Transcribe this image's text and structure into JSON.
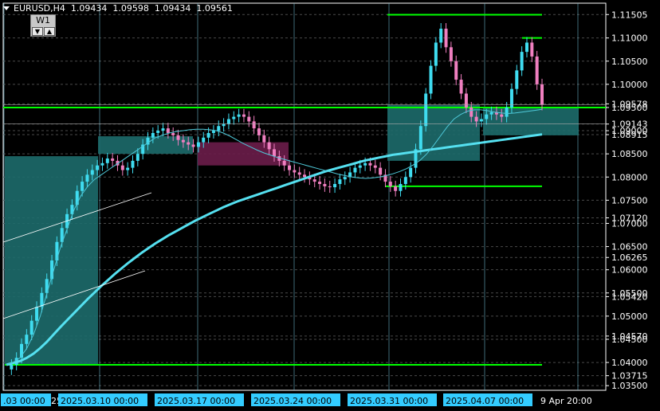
{
  "header": {
    "symbol": "EURUSD,H4",
    "open": "1.09434",
    "high": "1.09598",
    "low": "1.09434",
    "close": "1.09561"
  },
  "period_widget": {
    "label": "W1",
    "down_icon": "▼",
    "up_icon": "▲"
  },
  "colors": {
    "background": "#000000",
    "grid": "#4a4a4a",
    "bull": "#3fdcf0",
    "bear": "#f07fc0",
    "ma_slow": "#55e0f0",
    "ma_fast": "#4ec8d8",
    "level_green": "#00ff00",
    "box_teal": "#1d6b6b",
    "box_purple": "#6b1d4a",
    "axis_text": "#ffffff",
    "label_bg": "#33ccff"
  },
  "chart_data": {
    "type": "candlestick",
    "symbol": "EURUSD",
    "timeframe": "H4",
    "ylim": [
      1.034,
      1.1175
    ],
    "price_axis_labels": [
      "1.11505",
      "1.11000",
      "1.10500",
      "1.10000",
      "1.09578",
      "1.09500",
      "1.09143",
      "1.09000",
      "1.08915",
      "1.08500",
      "1.08000",
      "1.07500",
      "1.07120",
      "1.07000",
      "1.06500",
      "1.06265",
      "1.06000",
      "1.05500",
      "1.05420",
      "1.05000",
      "1.04570",
      "1.04500",
      "1.04000",
      "1.03715",
      "1.03500"
    ],
    "time_axis_labels": [
      {
        "text": ".03 00:00",
        "highlight": true
      },
      {
        "text": "25",
        "highlight": false
      },
      {
        "text": "2025.03.10 00:00",
        "highlight": true
      },
      {
        "text": "2025.03.17 00:00",
        "highlight": true
      },
      {
        "text": "2025.03.24 00:00",
        "highlight": true
      },
      {
        "text": "2025.03.31 00:00",
        "highlight": true
      },
      {
        "text": "2025.04.07 00:00",
        "highlight": true
      },
      {
        "text": "9 Apr 20:00",
        "highlight": false
      }
    ],
    "series": [
      {
        "kind": "close_path",
        "values": [
          1.0385,
          1.0395,
          1.041,
          1.044,
          1.046,
          1.049,
          1.052,
          1.055,
          1.058,
          1.062,
          1.066,
          1.069,
          1.072,
          1.074,
          1.077,
          1.079,
          1.0805,
          1.0815,
          1.0825,
          1.083,
          1.084,
          1.0835,
          1.0825,
          1.0815,
          1.082,
          1.0835,
          1.085,
          1.087,
          1.0885,
          1.0895,
          1.09,
          1.0905,
          1.0895,
          1.089,
          1.088,
          1.0875,
          1.087,
          1.0865,
          1.0875,
          1.0885,
          1.0895,
          1.09,
          1.091,
          1.0915,
          1.0925,
          1.093,
          1.0935,
          1.093,
          1.092,
          1.0905,
          1.089,
          1.0875,
          1.086,
          1.0845,
          1.0835,
          1.0825,
          1.0815,
          1.081,
          1.0805,
          1.08,
          1.0795,
          1.079,
          1.0785,
          1.078,
          1.0778,
          1.0785,
          1.0795,
          1.08,
          1.081,
          1.082,
          1.0825,
          1.083,
          1.0825,
          1.082,
          1.0805,
          1.079,
          1.078,
          1.077,
          1.0785,
          1.08,
          1.082,
          1.086,
          1.091,
          1.098,
          1.104,
          1.109,
          1.112,
          1.108,
          1.105,
          1.101,
          1.098,
          1.095,
          1.093,
          1.092,
          1.0925,
          1.0935,
          1.094,
          1.0935,
          1.093,
          1.095,
          1.099,
          1.103,
          1.107,
          1.109,
          1.106,
          1.1,
          1.0956
        ]
      },
      {
        "kind": "slow_ma",
        "values": [
          1.0395,
          1.0399,
          1.0403,
          1.041,
          1.0419,
          1.0431,
          1.0445,
          1.0461,
          1.0477,
          1.0492,
          1.0507,
          1.0522,
          1.0537,
          1.0551,
          1.0565,
          1.0578,
          1.0591,
          1.0603,
          1.0615,
          1.0626,
          1.0637,
          1.0647,
          1.0657,
          1.0666,
          1.0675,
          1.0683,
          1.0691,
          1.0699,
          1.0707,
          1.0714,
          1.0721,
          1.0728,
          1.0735,
          1.0741,
          1.0747,
          1.0752,
          1.0757,
          1.0762,
          1.0767,
          1.0772,
          1.0777,
          1.0782,
          1.0787,
          1.0792,
          1.0797,
          1.0802,
          1.0807,
          1.0812,
          1.0816,
          1.082,
          1.0824,
          1.0828,
          1.0832,
          1.0836,
          1.0839,
          1.0842,
          1.0845,
          1.0848,
          1.085,
          1.0852,
          1.0854,
          1.0856,
          1.0858,
          1.086,
          1.0862,
          1.0864,
          1.0866,
          1.0868,
          1.087,
          1.0872,
          1.0874,
          1.0876,
          1.0878,
          1.088,
          1.0882,
          1.0884,
          1.0886,
          1.0888,
          1.089,
          1.0892
        ]
      },
      {
        "kind": "fast_ma",
        "values": [
          1.0395,
          1.04,
          1.041,
          1.043,
          1.046,
          1.05,
          1.055,
          1.06,
          1.065,
          1.069,
          1.073,
          1.076,
          1.078,
          1.0795,
          1.0805,
          1.0815,
          1.0825,
          1.0835,
          1.0845,
          1.0855,
          1.0865,
          1.0875,
          1.0885,
          1.089,
          1.0895,
          1.0898,
          1.09,
          1.0902,
          1.0903,
          1.0903,
          1.0902,
          1.09,
          1.0895,
          1.0888,
          1.088,
          1.0872,
          1.0865,
          1.0858,
          1.0852,
          1.0847,
          1.0842,
          1.0838,
          1.0834,
          1.083,
          1.0826,
          1.0822,
          1.0818,
          1.0814,
          1.081,
          1.0806,
          1.0803,
          1.08,
          1.0798,
          1.0797,
          1.0798,
          1.08,
          1.0803,
          1.0807,
          1.0812,
          1.0818,
          1.0826,
          1.0836,
          1.085,
          1.0868,
          1.0888,
          1.0908,
          1.0925,
          1.0935,
          1.0942,
          1.0945,
          1.0945,
          1.0943,
          1.094,
          1.0938,
          1.0937,
          1.0938,
          1.094,
          1.0942,
          1.0944,
          1.0946
        ]
      }
    ],
    "levels": [
      1.115,
      1.11,
      1.095,
      1.078,
      1.0395
    ],
    "zones": [
      {
        "color": "teal",
        "from": 1.0395,
        "to": 1.0845
      },
      {
        "color": "teal",
        "from": 1.085,
        "to": 1.0888
      },
      {
        "color": "purple",
        "from": 1.0825,
        "to": 1.0875
      },
      {
        "color": "teal",
        "from": 1.0835,
        "to": 1.0955
      },
      {
        "color": "teal",
        "from": 1.089,
        "to": 1.095
      }
    ],
    "current_price": 1.09561,
    "grid": true
  }
}
